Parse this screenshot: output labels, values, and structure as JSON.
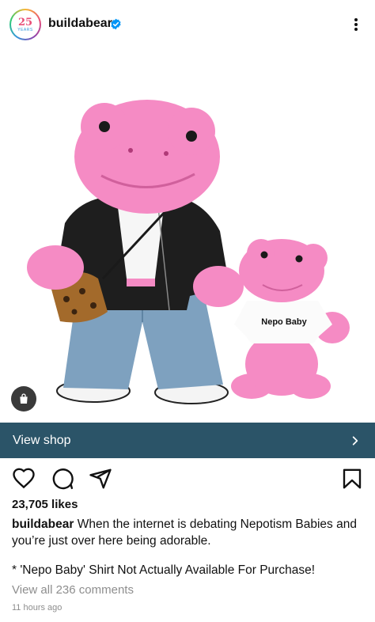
{
  "header": {
    "username": "buildabear",
    "avatar_number": "25",
    "avatar_sub": "YEARS",
    "verified_icon": "verified-badge-icon",
    "more_icon": "more-vertical-icon"
  },
  "media": {
    "shirt_text": "Nepo Baby",
    "shop_icon": "shopping-bag-icon"
  },
  "view_shop": {
    "label": "View shop",
    "chevron_icon": "chevron-right-icon"
  },
  "actions": {
    "like_icon": "heart-icon",
    "comment_icon": "comment-icon",
    "share_icon": "send-icon",
    "save_icon": "bookmark-icon"
  },
  "post": {
    "likes": "23,705 likes",
    "caption_user": "buildabear",
    "caption_text": "When the internet is debating Nepotism Babies and you’re just over here being adorable.",
    "footnote": "* 'Nepo Baby' Shirt Not Actually Available For Purchase!",
    "comments_link": "View all 236 comments",
    "timestamp": "11 hours ago"
  },
  "colors": {
    "shop_bar": "#2b5468",
    "plush_pink": "#f58bc4",
    "verified_blue": "#0095f6"
  }
}
